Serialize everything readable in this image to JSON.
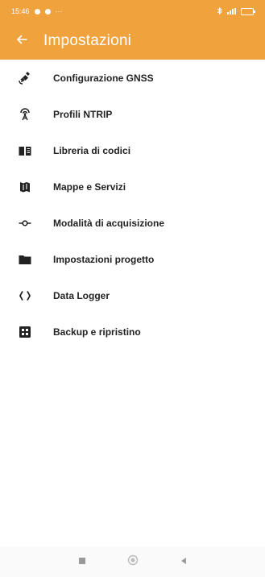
{
  "status_bar": {
    "time": "15:46"
  },
  "header": {
    "title": "Impostazioni",
    "back_icon": "arrow-left-icon",
    "background": "#f0a23c"
  },
  "menu": {
    "items": [
      {
        "label": "Configurazione GNSS",
        "icon": "satellite-icon"
      },
      {
        "label": "Profili NTRIP",
        "icon": "antenna-icon"
      },
      {
        "label": "Libreria di codici",
        "icon": "book-icon"
      },
      {
        "label": "Mappe e Servizi",
        "icon": "map-icon"
      },
      {
        "label": "Modalità di acquisizione",
        "icon": "commit-icon"
      },
      {
        "label": "Impostazioni progetto",
        "icon": "folder-icon"
      },
      {
        "label": "Data Logger",
        "icon": "code-braces-icon"
      },
      {
        "label": "Backup e ripristino",
        "icon": "grid-icon"
      }
    ]
  },
  "nav_bar": {
    "recent_icon": "square-icon",
    "home_icon": "circle-icon",
    "back_icon": "triangle-back-icon"
  }
}
